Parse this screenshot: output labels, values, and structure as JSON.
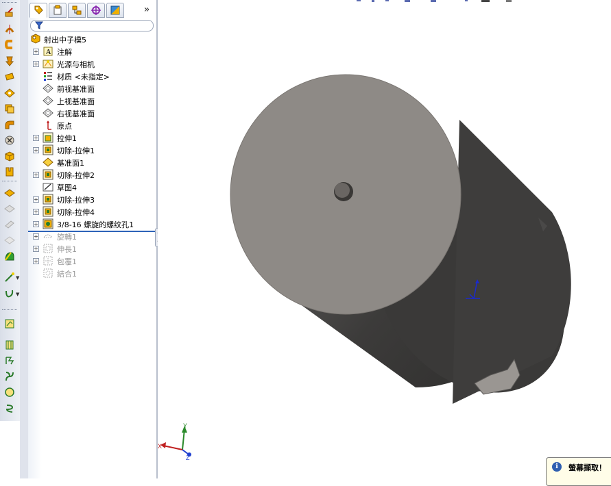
{
  "feature_manager": {
    "tabs": [
      {
        "name": "featuremanager-tab"
      },
      {
        "name": "propertymanager-tab"
      },
      {
        "name": "configurationmanager-tab"
      },
      {
        "name": "dimxpert-tab"
      },
      {
        "name": "display-manager-tab"
      }
    ],
    "more_label": "»",
    "root": {
      "label": "射出中子模5",
      "icon": "part-icon"
    },
    "items": [
      {
        "label": "注解",
        "icon": "annotations-icon",
        "expandable": true,
        "suppressed": false
      },
      {
        "label": "光源与相机",
        "icon": "lights-cameras-icon",
        "expandable": true,
        "suppressed": false
      },
      {
        "label": "材质 <未指定>",
        "icon": "material-icon",
        "expandable": false,
        "suppressed": false
      },
      {
        "label": "前视基准面",
        "icon": "plane-icon",
        "expandable": false,
        "suppressed": false
      },
      {
        "label": "上视基准面",
        "icon": "plane-icon",
        "expandable": false,
        "suppressed": false
      },
      {
        "label": "右视基准面",
        "icon": "plane-icon",
        "expandable": false,
        "suppressed": false
      },
      {
        "label": "原点",
        "icon": "origin-icon",
        "expandable": false,
        "suppressed": false
      },
      {
        "label": "拉伸1",
        "icon": "boss-extrude-icon",
        "expandable": true,
        "suppressed": false
      },
      {
        "label": "切除-拉伸1",
        "icon": "cut-extrude-icon",
        "expandable": true,
        "suppressed": false
      },
      {
        "label": "基准面1",
        "icon": "reference-plane-icon",
        "expandable": false,
        "suppressed": false
      },
      {
        "label": "切除-拉伸2",
        "icon": "cut-extrude-icon",
        "expandable": true,
        "suppressed": false
      },
      {
        "label": "草图4",
        "icon": "sketch-icon",
        "expandable": false,
        "suppressed": false
      },
      {
        "label": "切除-拉伸3",
        "icon": "cut-extrude-icon",
        "expandable": true,
        "suppressed": false
      },
      {
        "label": "切除-拉伸4",
        "icon": "cut-extrude-icon",
        "expandable": true,
        "suppressed": false
      },
      {
        "label": "3/8-16 螺旋的螺纹孔1",
        "icon": "hole-wizard-icon",
        "expandable": true,
        "suppressed": false
      },
      {
        "label": "旋轉1",
        "icon": "revolve-icon",
        "expandable": true,
        "suppressed": true
      },
      {
        "label": "伸長1",
        "icon": "extrude-icon",
        "expandable": true,
        "suppressed": true
      },
      {
        "label": "包覆1",
        "icon": "wrap-icon",
        "expandable": true,
        "suppressed": true
      },
      {
        "label": "結合1",
        "icon": "combine-icon",
        "expandable": false,
        "suppressed": true
      }
    ]
  },
  "viewport": {
    "model_colors": {
      "face": "#8e8a86",
      "body_dark": "#3c3b3a",
      "body_mid": "#6a6866"
    },
    "triad": {
      "x_label": "X",
      "y_label": "Y",
      "z_label": "Z"
    }
  },
  "popup": {
    "title": "螢幕擷取！",
    "icon": "info-icon"
  },
  "toolbar": {
    "tools": [
      "extruded-boss-icon",
      "revolved-boss-icon",
      "swept-boss-icon",
      "lofted-boss-icon",
      "extruded-cut-icon",
      "hole-wizard-icon",
      "revolved-cut-icon",
      "swept-cut-icon",
      "fillet-icon",
      "linear-pattern-icon",
      "rib-icon",
      "draft-icon",
      "shell-icon",
      "reference-geometry-icon",
      "mirror-icon",
      "dome-icon",
      "curves-icon",
      "instant3d-icon"
    ]
  }
}
